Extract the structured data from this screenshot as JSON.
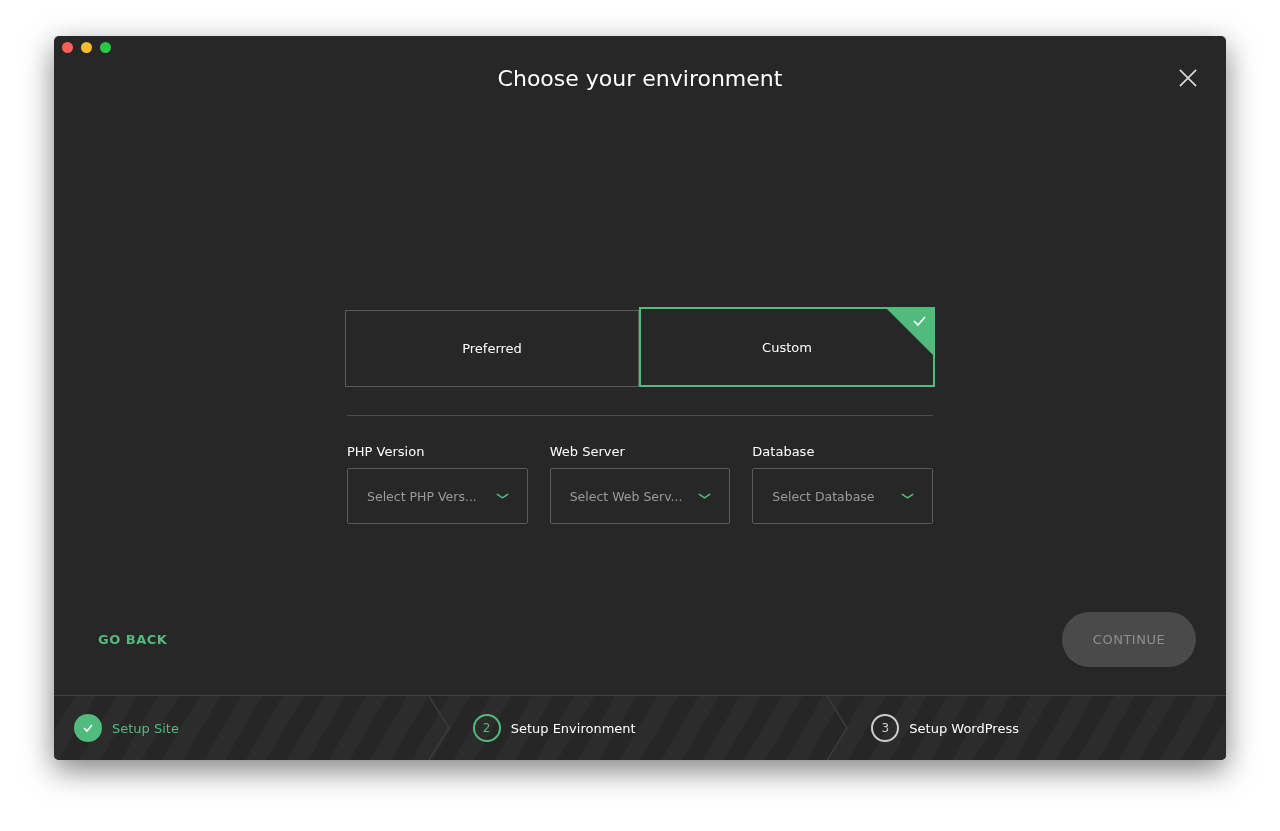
{
  "window": {
    "title": "Choose your environment"
  },
  "options": [
    {
      "label": "Preferred",
      "selected": false
    },
    {
      "label": "Custom",
      "selected": true
    }
  ],
  "fields": [
    {
      "label": "PHP Version",
      "placeholder": "Select PHP Vers..."
    },
    {
      "label": "Web Server",
      "placeholder": "Select Web Serv..."
    },
    {
      "label": "Database",
      "placeholder": "Select Database"
    }
  ],
  "go_back": "GO BACK",
  "continue": {
    "label": "CONTINUE",
    "disabled": true
  },
  "steps": [
    {
      "label": "Setup Site",
      "kind": "done"
    },
    {
      "label": "Setup Environment",
      "number": "2",
      "kind": "current"
    },
    {
      "label": "Setup WordPress",
      "number": "3",
      "kind": "pending"
    }
  ]
}
